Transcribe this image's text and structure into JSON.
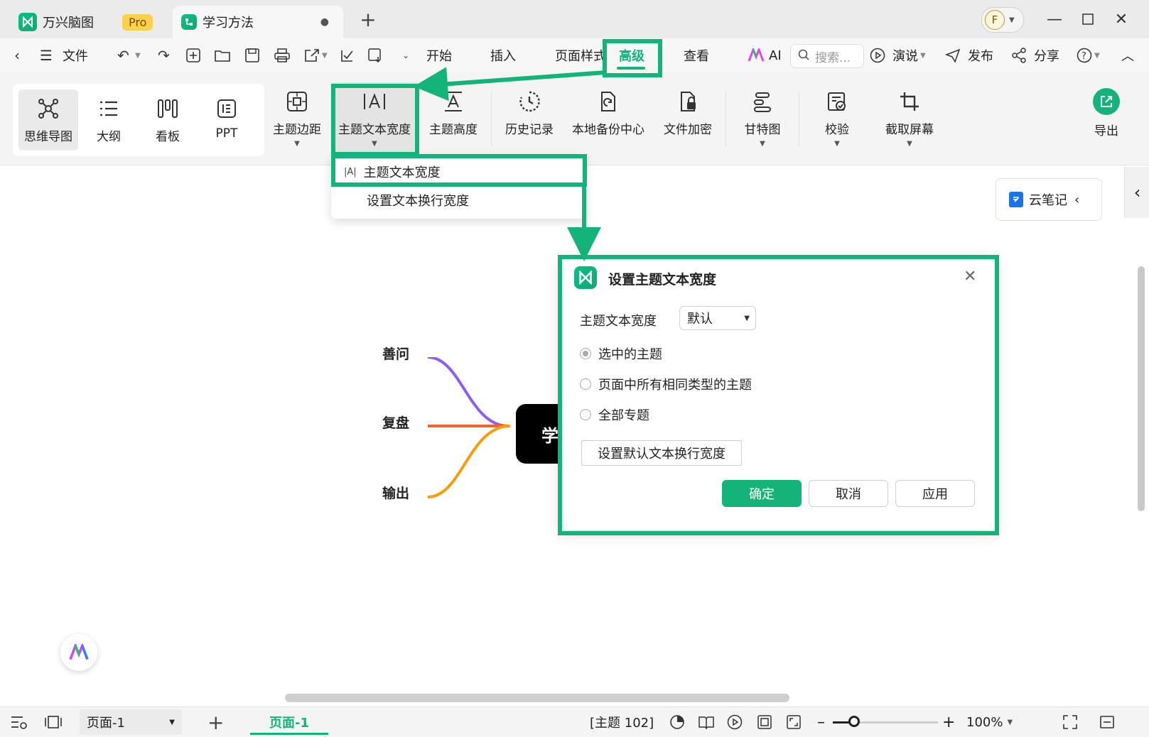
{
  "app": {
    "name": "万兴脑图",
    "pro_badge": "Pro"
  },
  "tabs": [
    {
      "label": "学习方法",
      "unsaved_dot": "●"
    }
  ],
  "window": {
    "avatar_initial": "F"
  },
  "menubar": {
    "file": "文件",
    "items": [
      "开始",
      "插入",
      "页面样式",
      "高级",
      "查看"
    ],
    "active": "高级",
    "ai": "AI",
    "search_placeholder": "搜索...",
    "present": "演说",
    "publish": "发布",
    "share": "分享"
  },
  "ribbon": {
    "views": [
      "思维导图",
      "大纲",
      "看板",
      "PPT"
    ],
    "tools": [
      "主题边距",
      "主题文本宽度",
      "主题高度",
      "历史记录",
      "本地备份中心",
      "文件加密",
      "甘特图",
      "校验",
      "截取屏幕"
    ],
    "export": "导出"
  },
  "dropdown": {
    "items": [
      {
        "icon": "|A|",
        "label": "主题文本宽度"
      },
      {
        "label": "设置文本换行宽度"
      }
    ]
  },
  "side_panel": {
    "cloud_note": "云笔记"
  },
  "mindmap": {
    "central_topic": "学",
    "branches": [
      {
        "label": "善问",
        "color": "#8b5cf6"
      },
      {
        "label": "复盘",
        "color": "#f0642d"
      },
      {
        "label": "输出",
        "color": "#f59e0b"
      }
    ]
  },
  "dialog": {
    "title": "设置主题文本宽度",
    "width_label": "主题文本宽度",
    "width_value": "默认",
    "options": [
      {
        "label": "选中的主题",
        "checked": true
      },
      {
        "label": "页面中所有相同类型的主题",
        "checked": false
      },
      {
        "label": "全部专题",
        "checked": false
      }
    ],
    "set_default_button": "设置默认文本换行宽度",
    "ok": "确定",
    "cancel": "取消",
    "apply": "应用"
  },
  "statusbar": {
    "page_select": "页面-1",
    "active_page_tab": "页面-1",
    "topic_count": "[主题 102]",
    "zoom": "100%",
    "zoom_level": 0.2
  },
  "colors": {
    "accent": "#13b37a",
    "highlight_box": "#13b37a",
    "central_node": "#000000"
  }
}
